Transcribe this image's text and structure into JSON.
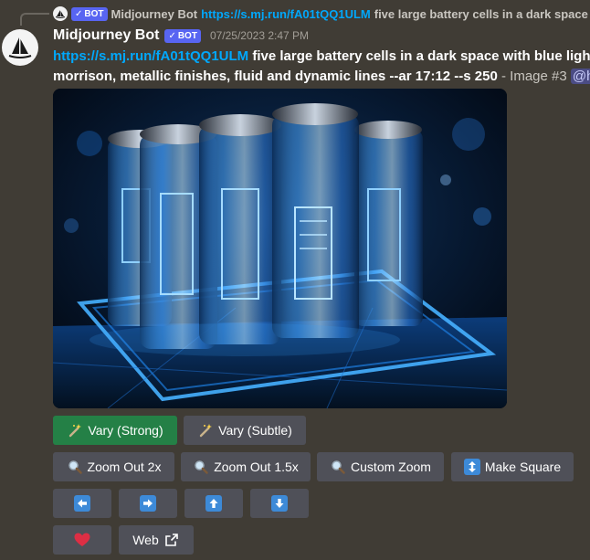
{
  "reply": {
    "author": "Midjourney Bot",
    "bot_tag": "BOT",
    "link": "https://s.mj.run/fA01tQQ1ULM",
    "text": "five large battery cells in a dark space"
  },
  "message": {
    "author": "Midjourney Bot",
    "bot_tag": "BOT",
    "timestamp": "07/25/2023 2:47 PM",
    "link": "https://s.mj.run/fA01tQQ1ULM",
    "prompt_line1": "five large battery cells in a dark space with blue ligh",
    "prompt_line2": "morrison, metallic finishes, fluid and dynamic lines --ar 17:12 --s 250",
    "suffix": "- Image #3",
    "mention": "@h"
  },
  "image": {
    "alt_icon": "battery-cells-image"
  },
  "buttons": {
    "vary_strong": "Vary (Strong)",
    "vary_subtle": "Vary (Subtle)",
    "zoom_out_2x": "Zoom Out 2x",
    "zoom_out_15x": "Zoom Out 1.5x",
    "custom_zoom": "Custom Zoom",
    "make_square": "Make Square",
    "web": "Web"
  },
  "colors": {
    "background": "#403c35",
    "link": "#00a8fc",
    "bot_tag": "#5865f2",
    "button": "#4f5058",
    "button_green": "#248046",
    "arrow_blue": "#3d8ad8",
    "heart": "#dd2e44"
  }
}
